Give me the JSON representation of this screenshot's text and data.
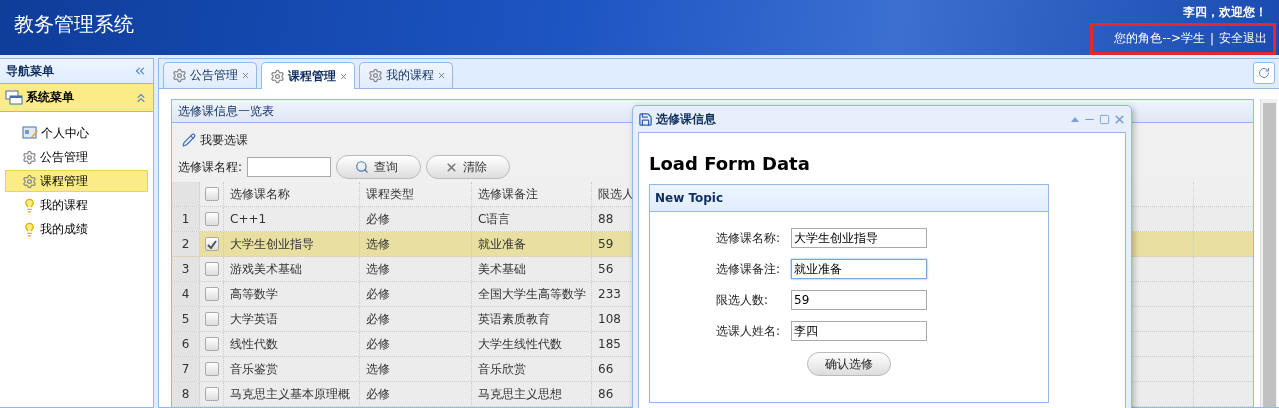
{
  "header": {
    "title": "教务管理系统",
    "welcome": "李四，欢迎您！",
    "role_link": "您的角色-->学生",
    "separator": "|",
    "logout_link": "安全退出"
  },
  "sidebar": {
    "title": "导航菜单",
    "section": {
      "label": "系统菜单",
      "expanded": true
    },
    "items": [
      {
        "label": "个人中心",
        "kind": "profile",
        "selected": false
      },
      {
        "label": "公告管理",
        "kind": "gear",
        "selected": false
      },
      {
        "label": "课程管理",
        "kind": "gear",
        "selected": true
      },
      {
        "label": "我的课程",
        "kind": "bulb",
        "selected": false
      },
      {
        "label": "我的成绩",
        "kind": "bulb",
        "selected": false
      }
    ]
  },
  "tabs": [
    {
      "label": "公告管理",
      "selected": false
    },
    {
      "label": "课程管理",
      "selected": true
    },
    {
      "label": "我的课程",
      "selected": false
    }
  ],
  "grid": {
    "title": "选修课信息一览表",
    "toolbar_button": "我要选课",
    "search_label": "选修课名程:",
    "search_button": "查询",
    "clear_button": "清除",
    "header_checked": false,
    "columns": [
      "选修课名称",
      "课程类型",
      "选修课备注",
      "限选人"
    ],
    "rows": [
      {
        "number": "1",
        "checked": false,
        "selected": false,
        "cells": [
          "C++1",
          "必修",
          "C语言",
          "88"
        ]
      },
      {
        "number": "2",
        "checked": true,
        "selected": true,
        "cells": [
          "大学生创业指导",
          "选修",
          "就业准备",
          "59"
        ]
      },
      {
        "number": "3",
        "checked": false,
        "selected": false,
        "cells": [
          "游戏美术基础",
          "选修",
          "美术基础",
          "56"
        ]
      },
      {
        "number": "4",
        "checked": false,
        "selected": false,
        "cells": [
          "高等数学",
          "必修",
          "全国大学生高等数学",
          "233"
        ]
      },
      {
        "number": "5",
        "checked": false,
        "selected": false,
        "cells": [
          "大学英语",
          "必修",
          "英语素质教育",
          "108"
        ]
      },
      {
        "number": "6",
        "checked": false,
        "selected": false,
        "cells": [
          "线性代数",
          "必修",
          "大学生线性代数",
          "185"
        ]
      },
      {
        "number": "7",
        "checked": false,
        "selected": false,
        "cells": [
          "音乐鉴赏",
          "选修",
          "音乐欣赏",
          "66"
        ]
      },
      {
        "number": "8",
        "checked": false,
        "selected": false,
        "cells": [
          "马克思主义基本原理概",
          "必修",
          "马克思主义思想",
          "86"
        ]
      }
    ]
  },
  "dialog": {
    "title": "选修课信息",
    "heading": "Load Form Data",
    "panel_title": "New Topic",
    "fields": [
      {
        "label": "选修课名称:",
        "value": "大学生创业指导",
        "focused": false
      },
      {
        "label": "选修课备注:",
        "value": "就业准备",
        "focused": true
      },
      {
        "label": "限选人数:",
        "value": "59",
        "focused": false
      },
      {
        "label": "选课人姓名:",
        "value": "李四",
        "focused": false
      }
    ],
    "submit": "确认选修"
  }
}
